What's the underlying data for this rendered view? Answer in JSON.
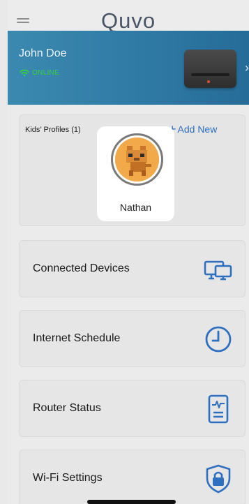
{
  "app": {
    "logo_text": "Quvo"
  },
  "banner": {
    "user_name": "John Doe",
    "status": "ONLINE",
    "status_color": "#38d13f",
    "accent": "#2f7aa5"
  },
  "kids": {
    "title": "Kids’ Profiles (1)",
    "add_new_label": "Add New",
    "profiles": [
      {
        "name": "Nathan"
      }
    ]
  },
  "menu": {
    "items": [
      {
        "label": "Connected Devices",
        "icon": "devices-icon"
      },
      {
        "label": "Internet Schedule",
        "icon": "clock-icon"
      },
      {
        "label": "Router Status",
        "icon": "router-status-icon"
      },
      {
        "label": "Wi-Fi Settings",
        "icon": "shield-lock-icon"
      }
    ]
  },
  "colors": {
    "icon_blue": "#2f6fbf",
    "text": "#1a1a1a"
  }
}
